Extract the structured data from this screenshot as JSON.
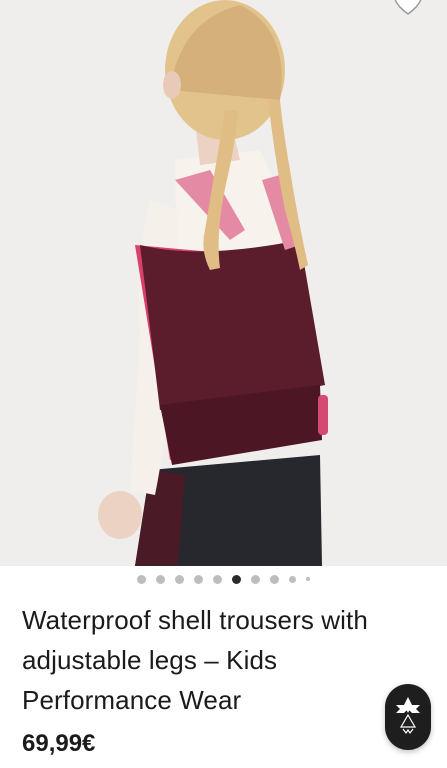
{
  "product": {
    "title": "Waterproof shell trousers with adjustable legs – Kids Performance Wear",
    "price": "69,99€"
  },
  "gallery": {
    "image_count": 10,
    "active_index": 5
  },
  "icons": {
    "favorite": "heart-outline-icon",
    "brand": "brand-logo-icon"
  },
  "colors": {
    "text": "#1b1b1b",
    "active_dot": "#2a2a2a",
    "inactive_dot": "#bdbdbd",
    "fab": "#1e1e1e"
  }
}
